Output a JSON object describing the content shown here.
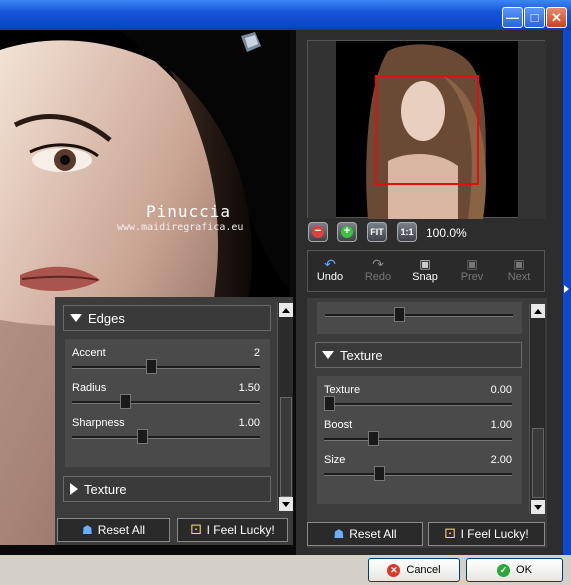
{
  "window": {
    "minimize_icon": "minimize-icon",
    "maximize_icon": "maximize-icon",
    "close_icon": "close-icon"
  },
  "preview": {
    "logo": "TOPAZ LABS",
    "watermark_name": "Pinuccia",
    "watermark_url": "www.maidiregrafica.eu"
  },
  "left_panel": {
    "edges": {
      "title": "Edges",
      "params": [
        {
          "label": "Accent",
          "value": "2",
          "fraction": 0.42
        },
        {
          "label": "Radius",
          "value": "1.50",
          "fraction": 0.27
        },
        {
          "label": "Sharpness",
          "value": "1.00",
          "fraction": 0.37
        }
      ]
    },
    "texture_header": "Texture",
    "reset_label": "Reset All",
    "lucky_label": "I Feel Lucky!"
  },
  "navigator": {
    "zoom_level": "100.0%",
    "zoom_buttons": [
      "zoom-out-icon",
      "zoom-in-icon",
      "FIT",
      "1:1"
    ]
  },
  "toolbar": {
    "items": [
      {
        "label": "Undo",
        "icon": "undo-icon",
        "enabled": true
      },
      {
        "label": "Redo",
        "icon": "redo-icon",
        "enabled": false
      },
      {
        "label": "Snap",
        "icon": "camera-icon",
        "enabled": true
      },
      {
        "label": "Prev",
        "icon": "prev-icon",
        "enabled": false
      },
      {
        "label": "Next",
        "icon": "next-icon",
        "enabled": false
      }
    ]
  },
  "right_panel": {
    "texture": {
      "title": "Texture",
      "params": [
        {
          "label": "Texture",
          "value": "0.00",
          "fraction": 0.0
        },
        {
          "label": "Boost",
          "value": "1.00",
          "fraction": 0.25
        },
        {
          "label": "Size",
          "value": "2.00",
          "fraction": 0.28
        }
      ]
    },
    "reset_label": "Reset All",
    "lucky_label": "I Feel Lucky!"
  },
  "footer": {
    "cancel_label": "Cancel",
    "ok_label": "OK"
  }
}
